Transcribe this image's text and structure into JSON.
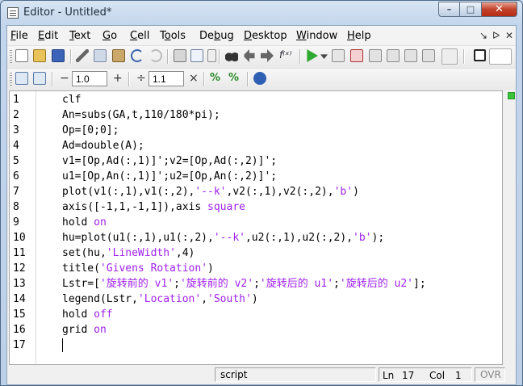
{
  "window": {
    "title": "Editor - Untitled*",
    "btn_min": "–",
    "btn_max": "□",
    "btn_close": "✕"
  },
  "menubar": {
    "items": [
      {
        "pre": "",
        "u": "F",
        "post": "ile"
      },
      {
        "pre": "",
        "u": "E",
        "post": "dit"
      },
      {
        "pre": "",
        "u": "T",
        "post": "ext"
      },
      {
        "pre": "",
        "u": "G",
        "post": "o"
      },
      {
        "pre": "",
        "u": "C",
        "post": "ell"
      },
      {
        "pre": "T",
        "u": "o",
        "post": "ols"
      },
      {
        "pre": "De",
        "u": "b",
        "post": "ug"
      },
      {
        "pre": "",
        "u": "D",
        "post": "esktop"
      },
      {
        "pre": "",
        "u": "W",
        "post": "indow"
      },
      {
        "pre": "",
        "u": "H",
        "post": "elp"
      }
    ],
    "right_icons": [
      "↘",
      "ᐅ",
      "✕"
    ]
  },
  "toolbar2": {
    "minus": "−",
    "value1": "1.0",
    "plus": "+",
    "divide": "÷",
    "value2": "1.1",
    "times": "×"
  },
  "code_lines": [
    {
      "n": "1",
      "segs": [
        {
          "t": "clf",
          "c": ""
        }
      ]
    },
    {
      "n": "2",
      "segs": [
        {
          "t": "An=subs(GA,t,110/180*pi);",
          "c": ""
        }
      ]
    },
    {
      "n": "3",
      "segs": [
        {
          "t": "Op=[0;0];",
          "c": ""
        }
      ]
    },
    {
      "n": "4",
      "segs": [
        {
          "t": "Ad=double(A);",
          "c": ""
        }
      ]
    },
    {
      "n": "5",
      "segs": [
        {
          "t": "v1=[Op,Ad(:,1)]';v2=[Op,Ad(:,2)]';",
          "c": ""
        }
      ]
    },
    {
      "n": "6",
      "segs": [
        {
          "t": "u1=[Op,An(:,1)]';u2=[Op,An(:,2)]';",
          "c": ""
        }
      ]
    },
    {
      "n": "7",
      "segs": [
        {
          "t": "plot(v1(:,1),v1(:,2),",
          "c": ""
        },
        {
          "t": "'--k'",
          "c": "str"
        },
        {
          "t": ",v2(:,1),v2(:,2),",
          "c": ""
        },
        {
          "t": "'b'",
          "c": "str"
        },
        {
          "t": ")",
          "c": ""
        }
      ]
    },
    {
      "n": "8",
      "segs": [
        {
          "t": "axis([-1,1,-1,1]),axis ",
          "c": ""
        },
        {
          "t": "square",
          "c": "str"
        }
      ]
    },
    {
      "n": "9",
      "segs": [
        {
          "t": "hold ",
          "c": ""
        },
        {
          "t": "on",
          "c": "str"
        }
      ]
    },
    {
      "n": "10",
      "segs": [
        {
          "t": "hu=plot(u1(:,1),u1(:,2),",
          "c": ""
        },
        {
          "t": "'--k'",
          "c": "str"
        },
        {
          "t": ",u2(:,1),u2(:,2),",
          "c": ""
        },
        {
          "t": "'b'",
          "c": "str"
        },
        {
          "t": ");",
          "c": ""
        }
      ]
    },
    {
      "n": "11",
      "segs": [
        {
          "t": "set(hu,",
          "c": ""
        },
        {
          "t": "'LineWidth'",
          "c": "str"
        },
        {
          "t": ",4)",
          "c": ""
        }
      ]
    },
    {
      "n": "12",
      "segs": [
        {
          "t": "title(",
          "c": ""
        },
        {
          "t": "'Givens Rotation'",
          "c": "str"
        },
        {
          "t": ")",
          "c": ""
        }
      ]
    },
    {
      "n": "13",
      "segs": [
        {
          "t": "Lstr=[",
          "c": ""
        },
        {
          "t": "'旋转前的 v1'",
          "c": "str"
        },
        {
          "t": ";",
          "c": ""
        },
        {
          "t": "'旋转前的 v2'",
          "c": "str"
        },
        {
          "t": ";",
          "c": ""
        },
        {
          "t": "'旋转后的 u1'",
          "c": "str"
        },
        {
          "t": ";",
          "c": ""
        },
        {
          "t": "'旋转后的 u2'",
          "c": "str"
        },
        {
          "t": "];",
          "c": ""
        }
      ]
    },
    {
      "n": "14",
      "segs": [
        {
          "t": "legend(Lstr,",
          "c": ""
        },
        {
          "t": "'Location'",
          "c": "str"
        },
        {
          "t": ",",
          "c": ""
        },
        {
          "t": "'South'",
          "c": "str"
        },
        {
          "t": ")",
          "c": ""
        }
      ]
    },
    {
      "n": "15",
      "segs": [
        {
          "t": "hold ",
          "c": ""
        },
        {
          "t": "off",
          "c": "str"
        }
      ]
    },
    {
      "n": "16",
      "segs": [
        {
          "t": "grid ",
          "c": ""
        },
        {
          "t": "on",
          "c": "str"
        }
      ]
    },
    {
      "n": "17",
      "segs": []
    }
  ],
  "statusbar": {
    "mode": "script",
    "ln_label": "Ln",
    "ln_value": "17",
    "col_label": "Col",
    "col_value": "1",
    "ovr": "OVR"
  },
  "colors": {
    "string": "#a020f0",
    "keyword": "#0000ff",
    "close_button": "#c2432b"
  }
}
